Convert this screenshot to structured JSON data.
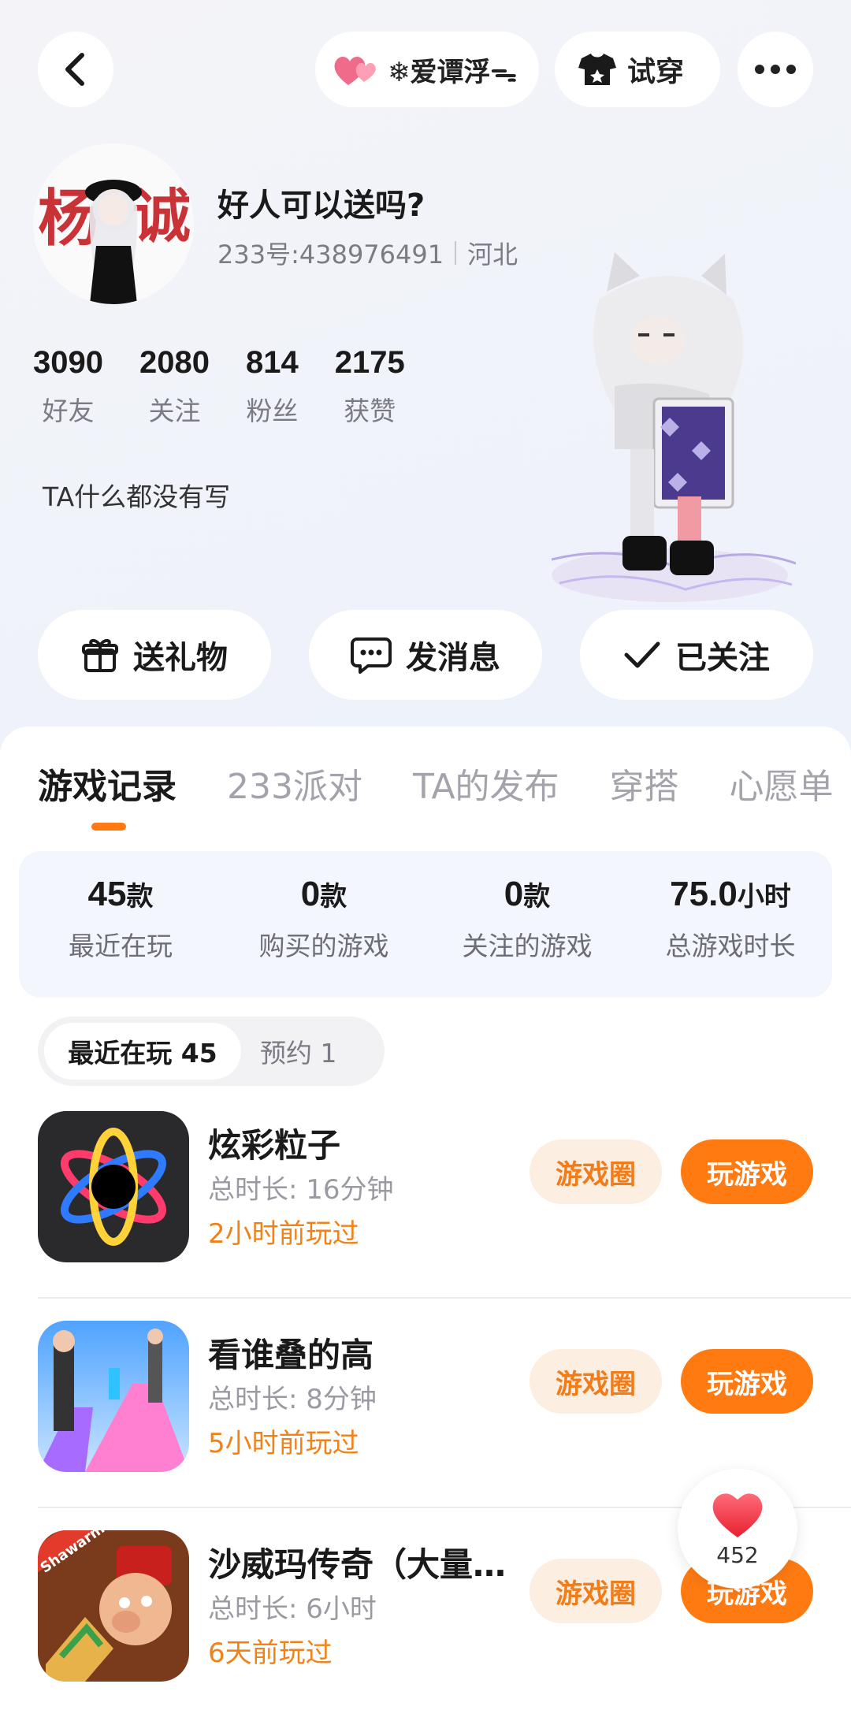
{
  "topbar": {
    "love_badge_text": "❄爱谭浮ᯓ",
    "try_on_label": "试穿"
  },
  "profile": {
    "username": "好人可以送吗?",
    "uid": "233号:438976491",
    "region": "河北",
    "stats": [
      {
        "value": "3090",
        "label": "好友"
      },
      {
        "value": "2080",
        "label": "关注"
      },
      {
        "value": "814",
        "label": "粉丝"
      },
      {
        "value": "2175",
        "label": "获赞"
      }
    ],
    "bio": "TA什么都没有写"
  },
  "actions": {
    "gift": "送礼物",
    "message": "发消息",
    "followed": "已关注"
  },
  "tabs": [
    "游戏记录",
    "233派对",
    "TA的发布",
    "穿搭",
    "心愿单"
  ],
  "summary": [
    {
      "value": "45",
      "unit": "款",
      "label": "最近在玩"
    },
    {
      "value": "0",
      "unit": "款",
      "label": "购买的游戏"
    },
    {
      "value": "0",
      "unit": "款",
      "label": "关注的游戏"
    },
    {
      "value": "75.0",
      "unit": "小时",
      "label": "总游戏时长"
    }
  ],
  "segments": {
    "recent": "最近在玩 45",
    "reserved": "预约 1"
  },
  "games": [
    {
      "title": "炫彩粒子",
      "duration": "总时长:  16分钟",
      "last_played": "2小时前玩过",
      "circle_label": "游戏圈",
      "play_label": "玩游戏"
    },
    {
      "title": "看谁叠的高",
      "duration": "总时长:  8分钟",
      "last_played": "5小时前玩过",
      "circle_label": "游戏圈",
      "play_label": "玩游戏"
    },
    {
      "title": "沙威玛传奇（大量…",
      "duration": "总时长:  6小时",
      "last_played": "6天前玩过",
      "circle_label": "游戏圈",
      "play_label": "玩游戏",
      "icon_text": "Shawarma"
    }
  ],
  "like_fab": {
    "count": "452"
  },
  "colors": {
    "accent": "#ff7b12",
    "accent_light": "#fdeee2"
  }
}
